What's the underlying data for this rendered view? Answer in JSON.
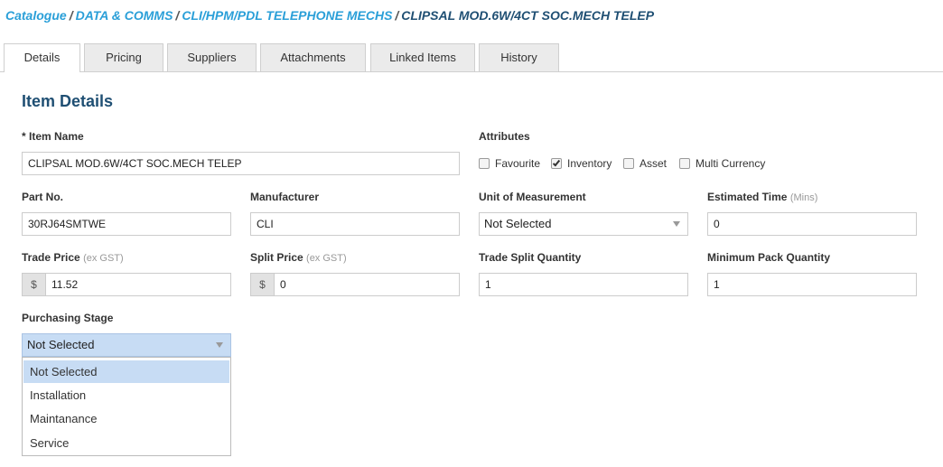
{
  "breadcrumb": {
    "items": [
      "Catalogue",
      "DATA & COMMS",
      "CLI/HPM/PDL TELEPHONE MECHS"
    ],
    "separator": "/",
    "current": "CLIPSAL MOD.6W/4CT SOC.MECH TELEP"
  },
  "tabs": [
    {
      "label": "Details",
      "active": true
    },
    {
      "label": "Pricing",
      "active": false
    },
    {
      "label": "Suppliers",
      "active": false
    },
    {
      "label": "Attachments",
      "active": false
    },
    {
      "label": "Linked Items",
      "active": false
    },
    {
      "label": "History",
      "active": false
    }
  ],
  "section_title": "Item Details",
  "fields": {
    "item_name": {
      "label": "* Item Name",
      "value": "CLIPSAL MOD.6W/4CT SOC.MECH TELEP"
    },
    "attributes": {
      "label": "Attributes",
      "options": [
        {
          "label": "Favourite",
          "checked": false
        },
        {
          "label": "Inventory",
          "checked": true
        },
        {
          "label": "Asset",
          "checked": false
        },
        {
          "label": "Multi Currency",
          "checked": false
        }
      ]
    },
    "part_no": {
      "label": "Part No.",
      "value": "30RJ64SMTWE"
    },
    "manufacturer": {
      "label": "Manufacturer",
      "value": "CLI"
    },
    "unit_of_measurement": {
      "label": "Unit of Measurement",
      "value": "Not Selected"
    },
    "estimated_time": {
      "label": "Estimated Time",
      "hint": "(Mins)",
      "value": "0"
    },
    "trade_price": {
      "label": "Trade Price",
      "hint": "(ex GST)",
      "currency": "$",
      "value": "11.52"
    },
    "split_price": {
      "label": "Split Price",
      "hint": "(ex GST)",
      "currency": "$",
      "value": "0"
    },
    "trade_split_quantity": {
      "label": "Trade Split Quantity",
      "value": "1"
    },
    "minimum_pack_quantity": {
      "label": "Minimum Pack Quantity",
      "value": "1"
    },
    "purchasing_stage": {
      "label": "Purchasing Stage",
      "value": "Not Selected",
      "options": [
        "Not Selected",
        "Installation",
        "Maintanance",
        "Service"
      ],
      "selected_index": 0,
      "open": true
    }
  }
}
